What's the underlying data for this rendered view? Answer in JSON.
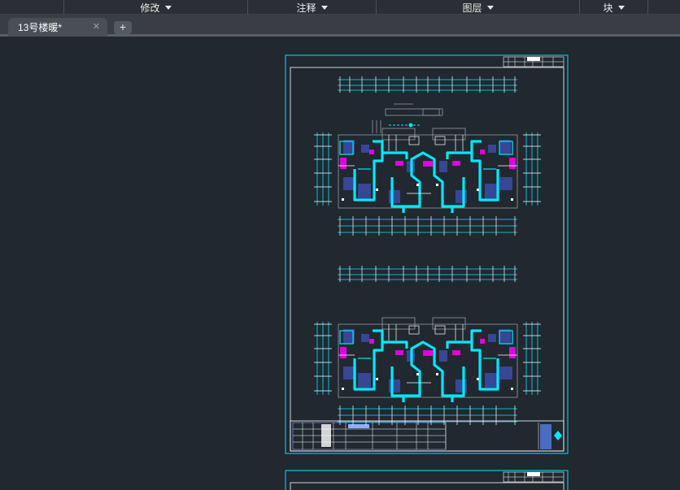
{
  "ribbon": {
    "panels": [
      {
        "label": "修改"
      },
      {
        "label": "注释"
      },
      {
        "label": "图层"
      },
      {
        "label": "块"
      }
    ]
  },
  "tabs": {
    "active": {
      "label": "13号楼暖*",
      "close_glyph": "✕"
    },
    "new_tab_glyph": "+"
  },
  "colors": {
    "background": "#212830",
    "sheet_border": "#00c8d8",
    "cad_cyan": "#00e8ff",
    "cad_magenta": "#e000e0",
    "cad_blue": "#3a4aa0",
    "cad_white": "#ffffff",
    "cad_gray": "#9a9a9a"
  },
  "icons": {
    "panel_dropdown": "chevron-down-icon",
    "tab_close": "close-icon",
    "new_tab": "plus-icon"
  }
}
